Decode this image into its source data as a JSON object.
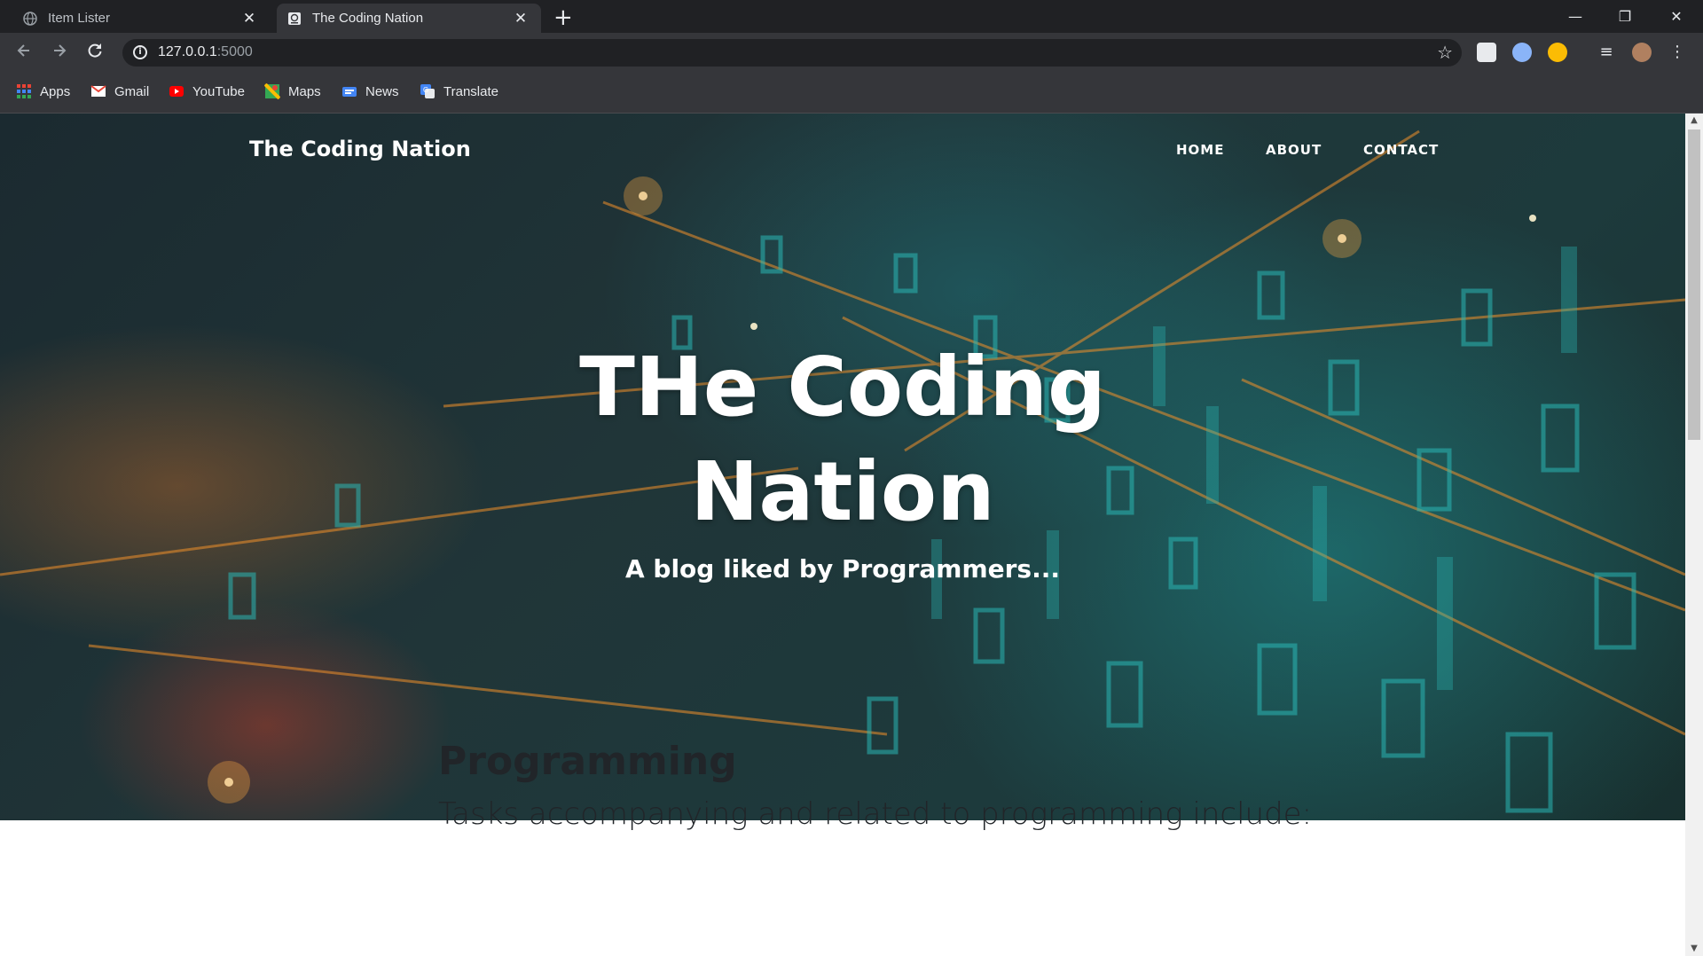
{
  "browser": {
    "tabs": [
      {
        "title": "Item Lister",
        "active": false,
        "favicon": "globe-icon"
      },
      {
        "title": "The Coding Nation",
        "active": true,
        "favicon": "site-icon"
      }
    ],
    "new_tab": "+",
    "window_controls": {
      "minimize": "—",
      "restore": "❐",
      "close": "✕"
    },
    "address": {
      "host": "127.0.0.1",
      "port": ":5000"
    },
    "bookmarks": [
      {
        "label": "Apps",
        "icon": "apps-grid-icon"
      },
      {
        "label": "Gmail",
        "icon": "gmail-icon"
      },
      {
        "label": "YouTube",
        "icon": "youtube-icon"
      },
      {
        "label": "Maps",
        "icon": "maps-icon"
      },
      {
        "label": "News",
        "icon": "news-icon"
      },
      {
        "label": "Translate",
        "icon": "translate-icon"
      }
    ]
  },
  "site": {
    "brand": "The Coding Nation",
    "nav": [
      "HOME",
      "ABOUT",
      "CONTACT"
    ],
    "hero": {
      "title_line1": "THe Coding",
      "title_line2": "Nation",
      "subtitle": "A blog liked by Programmers..."
    },
    "post": {
      "title": "Programming",
      "subtitle": "Tasks accompanying and related to programming include:"
    }
  },
  "colors": {
    "chrome_dark": "#202124",
    "chrome_toolbar": "#35363a",
    "hero_teal": "#2ab7b4",
    "hero_orange": "#f0902a",
    "text_dark": "#212529"
  }
}
